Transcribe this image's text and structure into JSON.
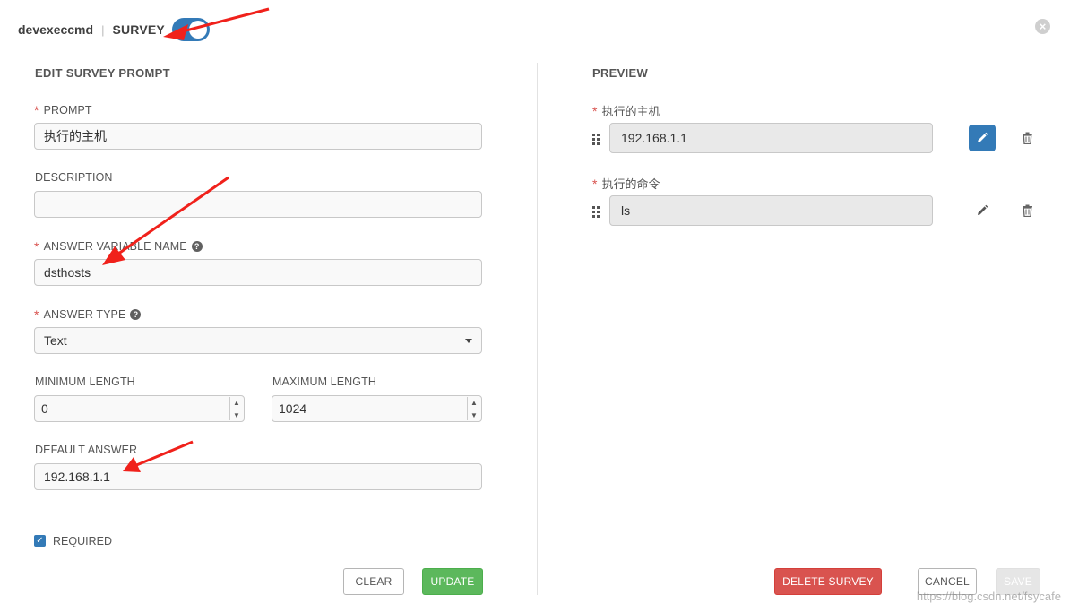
{
  "header": {
    "job_name": "devexeccmd",
    "separator": "|",
    "survey_title": "SURVEY",
    "close_icon": "close-icon"
  },
  "edit": {
    "title": "EDIT SURVEY PROMPT",
    "prompt": {
      "label": "PROMPT",
      "value": "执行的主机"
    },
    "description": {
      "label": "DESCRIPTION",
      "value": ""
    },
    "variable": {
      "label": "ANSWER VARIABLE NAME",
      "value": "dsthosts"
    },
    "answer_type": {
      "label": "ANSWER TYPE",
      "value": "Text"
    },
    "min_length": {
      "label": "MINIMUM LENGTH",
      "value": "0"
    },
    "max_length": {
      "label": "MAXIMUM LENGTH",
      "value": "1024"
    },
    "default_answer": {
      "label": "DEFAULT ANSWER",
      "value": "192.168.1.1"
    },
    "required": {
      "label": "REQUIRED",
      "checked": true
    },
    "clear_label": "CLEAR",
    "update_label": "UPDATE"
  },
  "preview": {
    "title": "PREVIEW",
    "items": [
      {
        "label": "执行的主机",
        "value": "192.168.1.1",
        "editing": true
      },
      {
        "label": "执行的命令",
        "value": "ls",
        "editing": false
      }
    ],
    "delete_label": "DELETE SURVEY",
    "cancel_label": "CANCEL",
    "save_label": "SAVE"
  },
  "colors": {
    "primary": "#337ab7",
    "success": "#5cb85c",
    "danger": "#d9534f",
    "required": "#d9534f",
    "annotation": "#f0211b"
  },
  "watermark": "https://blog.csdn.net/fsycafe"
}
